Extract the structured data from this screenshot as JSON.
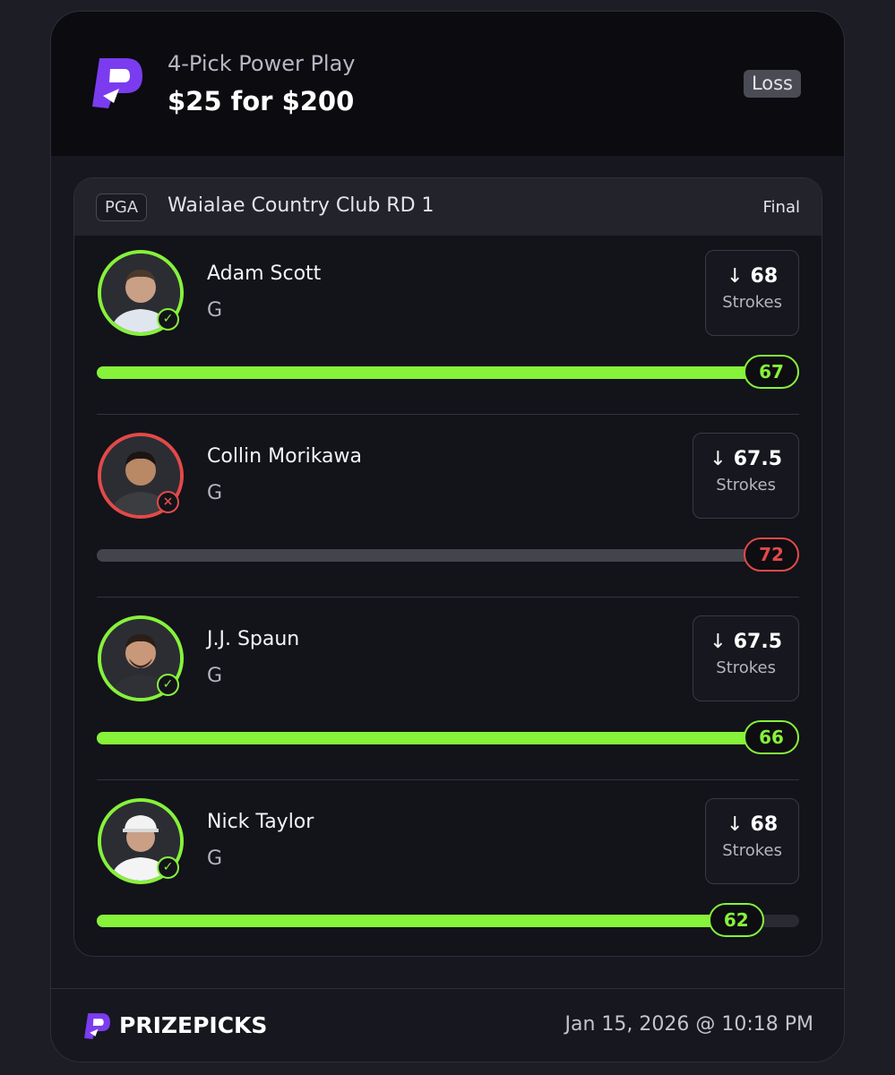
{
  "header": {
    "play_type": "4-Pick Power Play",
    "wager": "$25 for $200",
    "status": "Loss"
  },
  "event": {
    "league": "PGA",
    "title": "Waialae Country Club RD 1",
    "status": "Final"
  },
  "picks": [
    {
      "name": "Adam Scott",
      "position": "G",
      "direction": "down",
      "line": "68",
      "stat": "Strokes",
      "actual": "67",
      "result": "win",
      "progress": 1.0
    },
    {
      "name": "Collin Morikawa",
      "position": "G",
      "direction": "down",
      "line": "67.5",
      "stat": "Strokes",
      "actual": "72",
      "result": "loss",
      "progress": 1.0
    },
    {
      "name": "J.J. Spaun",
      "position": "G",
      "direction": "down",
      "line": "67.5",
      "stat": "Strokes",
      "actual": "66",
      "result": "win",
      "progress": 1.0
    },
    {
      "name": "Nick Taylor",
      "position": "G",
      "direction": "down",
      "line": "68",
      "stat": "Strokes",
      "actual": "62",
      "result": "win",
      "progress": 0.95
    }
  ],
  "footer": {
    "brand": "PRIZEPICKS",
    "timestamp": "Jan 15, 2026 @ 10:18 PM"
  },
  "colors": {
    "win": "#86f23a",
    "loss": "#e24a48",
    "brand": "#7b3cf0"
  }
}
